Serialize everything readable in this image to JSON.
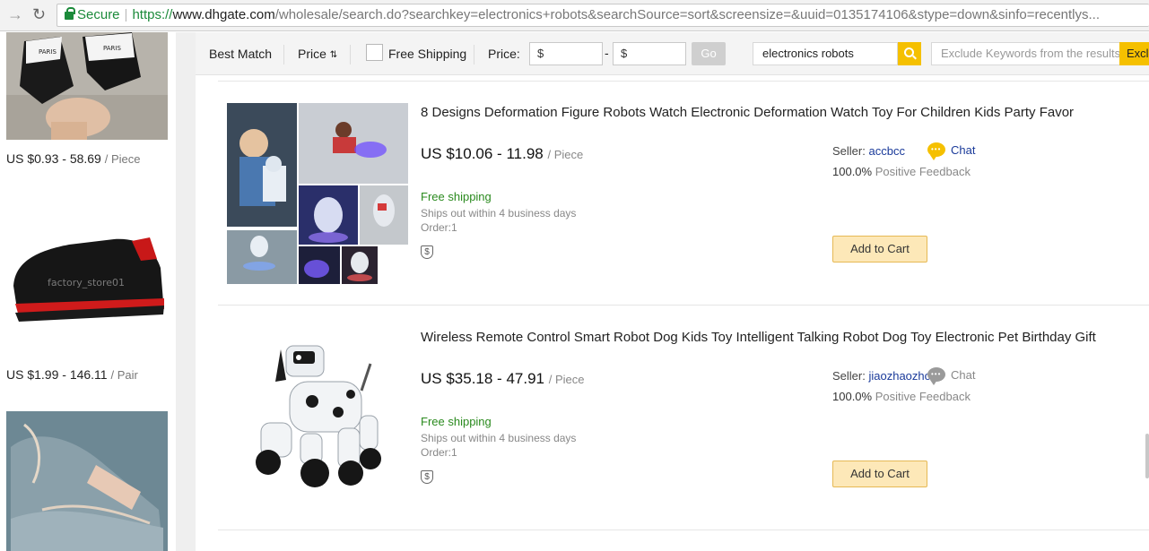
{
  "browser": {
    "secure_label": "Secure",
    "url_protocol": "https://",
    "url_host": "www.dhgate.com",
    "url_path": "/wholesale/search.do?searchkey=electronics+robots&searchSource=sort&screensize=&uuid=0135174106&stype=down&sinfo=recentlys..."
  },
  "left_products": [
    {
      "price": "US $0.93 - 58.69",
      "unit": "/ Piece",
      "image_text": "PARIS"
    },
    {
      "price": "US $1.99 - 146.11",
      "unit": "/ Pair",
      "image_text": "factory_store01"
    },
    {
      "price": "",
      "unit": ""
    }
  ],
  "filters": {
    "best_match": "Best Match",
    "price_sort": "Price",
    "free_shipping": "Free Shipping",
    "price_label": "Price:",
    "price_min_prefix": "$",
    "price_range_sep": "-",
    "price_max_prefix": "$",
    "go": "Go",
    "search_value": "electronics robots",
    "exclude_placeholder": "Exclude Keywords from the results",
    "exclude_button": "Exclu"
  },
  "results": [
    {
      "title": "8 Designs Deformation Figure Robots Watch Electronic Deformation Watch Toy For Children Kids Party Favor",
      "price": "US $10.06 - 11.98",
      "unit": "/ Piece",
      "shipping": "Free shipping",
      "ships_out": "Ships out within 4 business days",
      "order": "Order:1",
      "seller_label": "Seller:",
      "seller": "accbcc",
      "chat": "Chat",
      "chat_active": true,
      "feedback_value": "100.0%",
      "feedback_label": "Positive Feedback",
      "cart": "Add to Cart",
      "protection_icon": "$"
    },
    {
      "title": "Wireless Remote Control Smart Robot Dog Kids Toy Intelligent Talking Robot Dog Toy Electronic Pet Birthday Gift",
      "price": "US $35.18 - 47.91",
      "unit": "/ Piece",
      "shipping": "Free shipping",
      "ships_out": "Ships out within 4 business days",
      "order": "Order:1",
      "seller_label": "Seller:",
      "seller": "jiaozhaozhou",
      "chat": "Chat",
      "chat_active": false,
      "feedback_value": "100.0%",
      "feedback_label": "Positive Feedback",
      "cart": "Add to Cart",
      "protection_icon": "$"
    }
  ],
  "colors": {
    "accent": "#f5c000",
    "shipping_green": "#2a8a1e",
    "link_blue": "#1a3a9a",
    "cart_button": "#fde8b8"
  }
}
